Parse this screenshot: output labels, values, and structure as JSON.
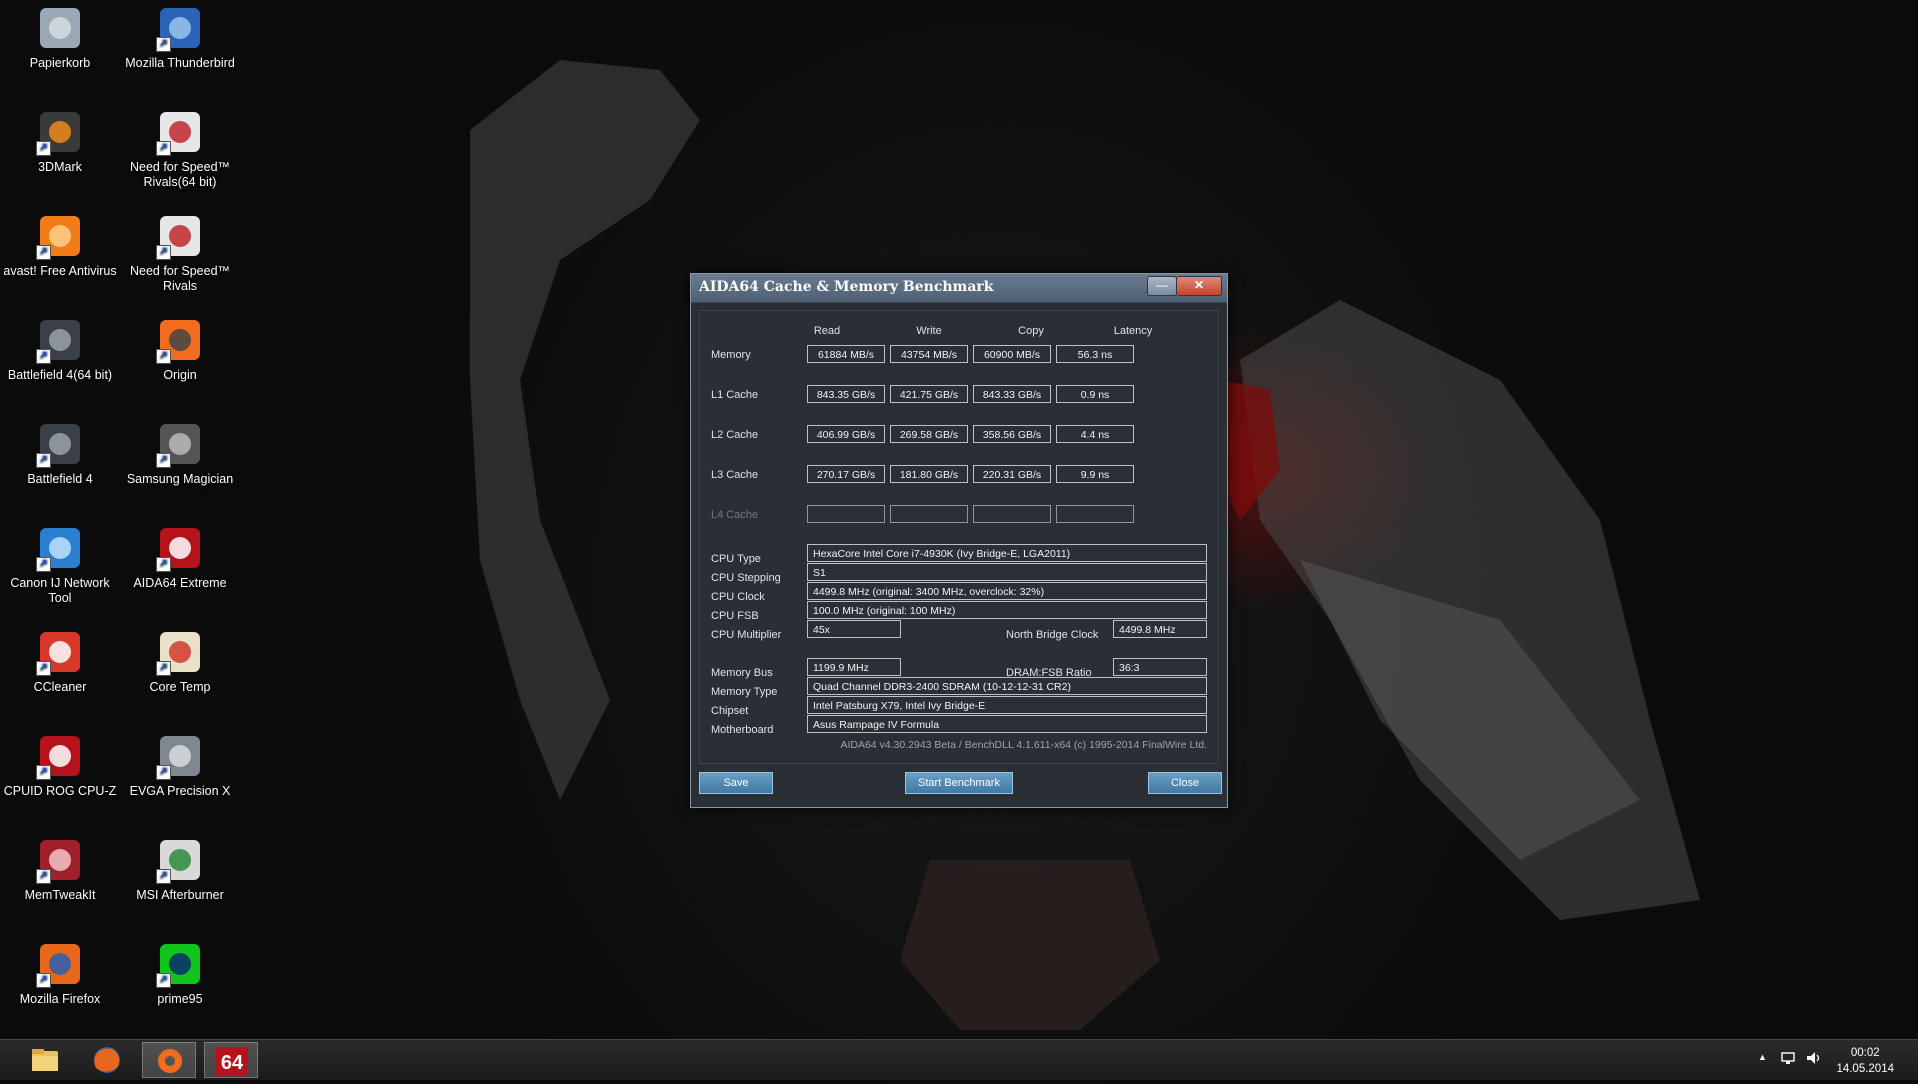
{
  "desktop": {
    "icons": [
      {
        "label": "Papierkorb",
        "icon": "recycle-bin-icon"
      },
      {
        "label": "Mozilla Thunderbird",
        "icon": "thunderbird-icon"
      },
      {
        "label": "3DMark",
        "icon": "3dmark-icon"
      },
      {
        "label": "Need for Speed™ Rivals(64 bit)",
        "icon": "nfs-icon"
      },
      {
        "label": "avast! Free Antivirus",
        "icon": "avast-icon"
      },
      {
        "label": "Need for Speed™ Rivals",
        "icon": "nfs-icon"
      },
      {
        "label": "Battlefield 4(64 bit)",
        "icon": "battlefield-icon"
      },
      {
        "label": "Origin",
        "icon": "origin-icon"
      },
      {
        "label": "Battlefield 4",
        "icon": "battlefield-icon"
      },
      {
        "label": "Samsung Magician",
        "icon": "samsung-magician-icon"
      },
      {
        "label": "Canon IJ Network Tool",
        "icon": "canon-network-icon"
      },
      {
        "label": "AIDA64 Extreme",
        "icon": "aida64-icon"
      },
      {
        "label": "CCleaner",
        "icon": "ccleaner-icon"
      },
      {
        "label": "Core Temp",
        "icon": "coretemp-icon"
      },
      {
        "label": "CPUID ROG CPU-Z",
        "icon": "cpuz-icon"
      },
      {
        "label": "EVGA Precision X",
        "icon": "evga-precision-icon"
      },
      {
        "label": "MemTweakIt",
        "icon": "memtweakit-icon"
      },
      {
        "label": "MSI Afterburner",
        "icon": "afterburner-icon"
      },
      {
        "label": "Mozilla Firefox",
        "icon": "firefox-icon"
      },
      {
        "label": "prime95",
        "icon": "prime95-icon"
      }
    ]
  },
  "dialog": {
    "title": "AIDA64 Cache & Memory Benchmark",
    "minimize": "—",
    "close": "✕",
    "headers": [
      "Read",
      "Write",
      "Copy",
      "Latency"
    ],
    "rows": [
      {
        "label": "Memory",
        "values": [
          "61884 MB/s",
          "43754 MB/s",
          "60900 MB/s",
          "56.3 ns"
        ]
      },
      {
        "label": "L1 Cache",
        "values": [
          "843.35 GB/s",
          "421.75 GB/s",
          "843.33 GB/s",
          "0.9 ns"
        ]
      },
      {
        "label": "L2 Cache",
        "values": [
          "406.99 GB/s",
          "269.58 GB/s",
          "358.56 GB/s",
          "4.4 ns"
        ]
      },
      {
        "label": "L3 Cache",
        "values": [
          "270.17 GB/s",
          "181.80 GB/s",
          "220.31 GB/s",
          "9.9 ns"
        ]
      },
      {
        "label": "L4 Cache",
        "values": [
          "",
          "",
          "",
          ""
        ]
      }
    ],
    "info": {
      "cpu_type_label": "CPU Type",
      "cpu_type": "HexaCore Intel Core i7-4930K  (Ivy Bridge-E, LGA2011)",
      "cpu_stepping_label": "CPU Stepping",
      "cpu_stepping": "S1",
      "cpu_clock_label": "CPU Clock",
      "cpu_clock": "4499.8 MHz  (original: 3400 MHz, overclock: 32%)",
      "cpu_fsb_label": "CPU FSB",
      "cpu_fsb": "100.0 MHz  (original: 100 MHz)",
      "cpu_mult_label": "CPU Multiplier",
      "cpu_mult": "45x",
      "nb_clock_label": "North Bridge Clock",
      "nb_clock": "4499.8 MHz",
      "mem_bus_label": "Memory Bus",
      "mem_bus": "1199.9 MHz",
      "dram_ratio_label": "DRAM:FSB Ratio",
      "dram_ratio": "36:3",
      "mem_type_label": "Memory Type",
      "mem_type": "Quad Channel DDR3-2400 SDRAM  (10-12-12-31 CR2)",
      "chipset_label": "Chipset",
      "chipset": "Intel Patsburg X79, Intel Ivy Bridge-E",
      "mobo_label": "Motherboard",
      "mobo": "Asus Rampage IV Formula"
    },
    "footer": "AIDA64 v4.30.2943 Beta / BenchDLL 4.1.611-x64  (c) 1995-2014 FinalWire Ltd.",
    "buttons": {
      "save": "Save",
      "start": "Start Benchmark",
      "close": "Close"
    }
  },
  "taskbar": {
    "items": [
      "file-explorer-icon",
      "firefox-icon",
      "origin-icon",
      "aida64-icon"
    ],
    "aida_label": "64",
    "tray_arrow": "▲",
    "time": "00:02",
    "date": "14.05.2014"
  }
}
